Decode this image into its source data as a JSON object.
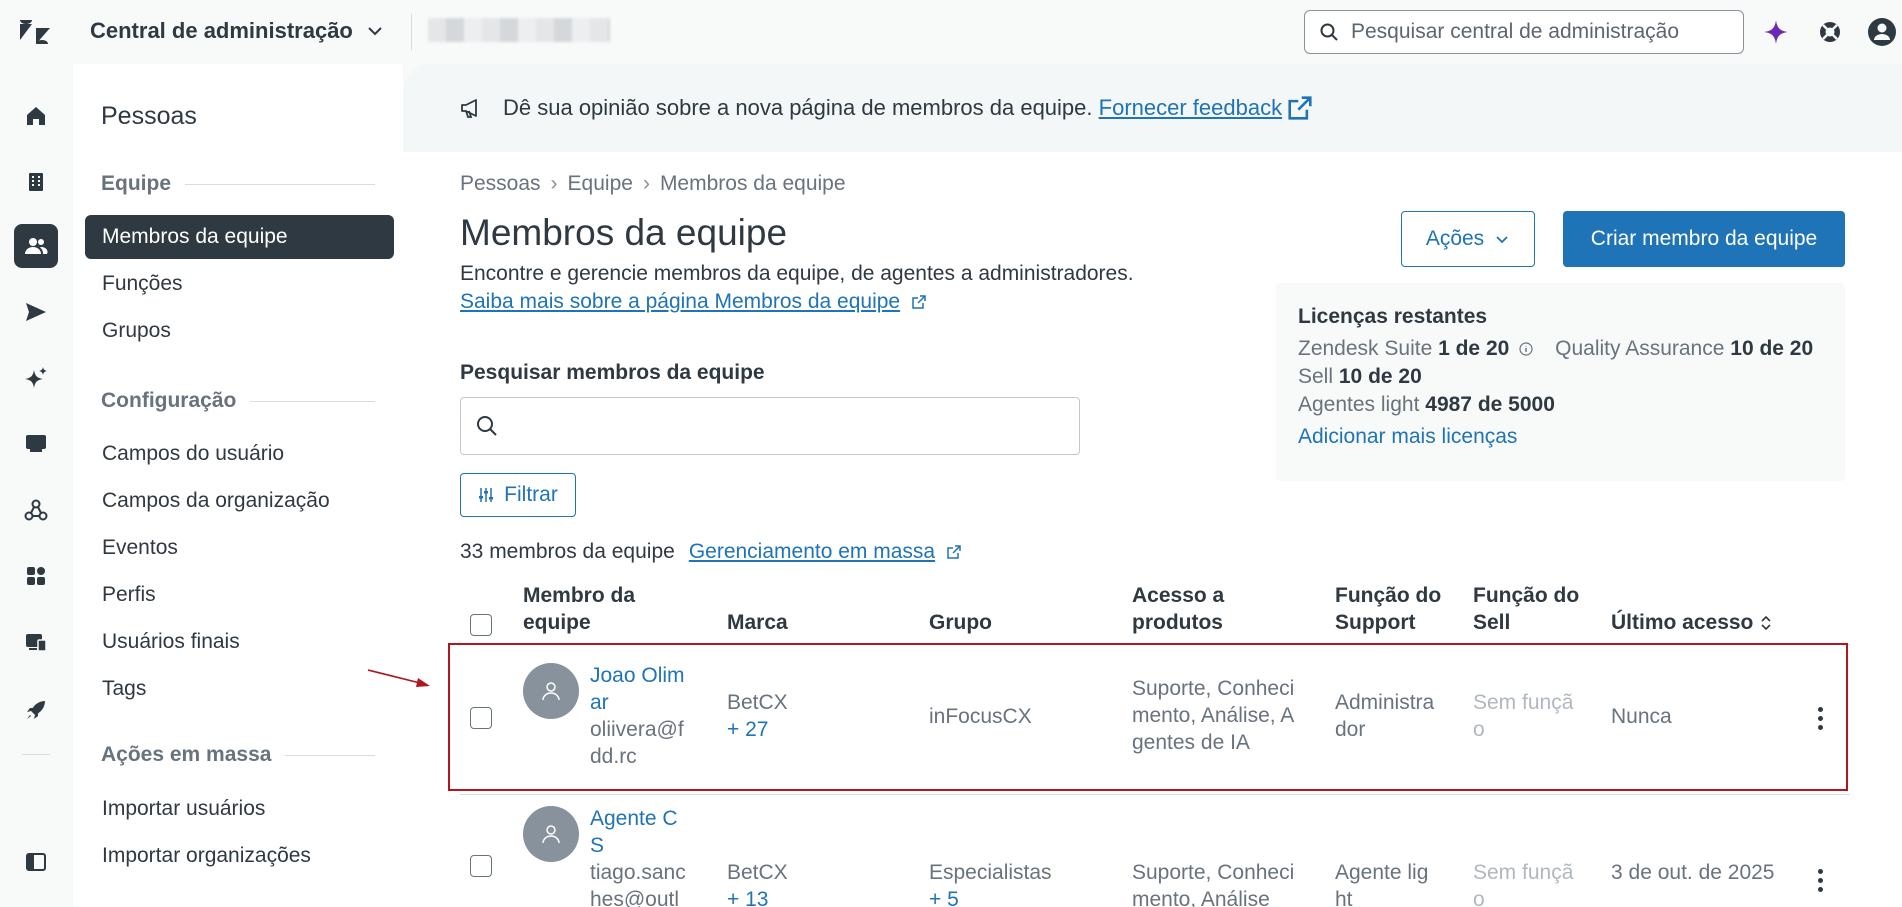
{
  "topbar": {
    "product_title": "Central de administração",
    "search_placeholder": "Pesquisar central de administração"
  },
  "subnav": {
    "title": "Pessoas",
    "sections": [
      {
        "heading": "Equipe",
        "items": [
          "Membros da equipe",
          "Funções",
          "Grupos"
        ]
      },
      {
        "heading": "Configuração",
        "items": [
          "Campos do usuário",
          "Campos da organização",
          "Eventos",
          "Perfis",
          "Usuários finais",
          "Tags"
        ]
      },
      {
        "heading": "Ações em massa",
        "items": [
          "Importar usuários",
          "Importar organizações"
        ]
      }
    ]
  },
  "banner": {
    "text": "Dê sua opinião sobre a nova página de membros da equipe.",
    "link": "Fornecer feedback"
  },
  "breadcrumb": [
    "Pessoas",
    "Equipe",
    "Membros da equipe"
  ],
  "page": {
    "title": "Membros da equipe",
    "description": "Encontre e gerencie membros da equipe, de agentes a administradores.",
    "learn_more": "Saiba mais sobre a página Membros da equipe",
    "actions_button": "Ações",
    "create_button": "Criar membro da equipe"
  },
  "licenses": {
    "title": "Licenças restantes",
    "zendesk_suite_label": "Zendesk Suite",
    "zendesk_suite_value": "1 de 20",
    "qa_label": "Quality Assurance",
    "qa_value": "10 de 20",
    "sell_label": "Sell",
    "sell_value": "10 de 20",
    "light_label": "Agentes light",
    "light_value": "4987 de 5000",
    "add_link": "Adicionar mais licenças"
  },
  "search": {
    "label": "Pesquisar membros da equipe",
    "placeholder": "",
    "filter_button": "Filtrar"
  },
  "table": {
    "count": "33 membros da equipe",
    "bulk_link": "Gerenciamento em massa",
    "columns": {
      "member": [
        "Membro da",
        "equipe"
      ],
      "brand": "Marca",
      "group": "Grupo",
      "access": [
        "Acesso a",
        "produtos"
      ],
      "support_role": [
        "Função do",
        "Support"
      ],
      "sell_role": [
        "Função do",
        "Sell"
      ],
      "last_access": "Último acesso"
    },
    "rows": [
      {
        "name": [
          "Joao Olim",
          "ar"
        ],
        "email": [
          "oliivera@f",
          "dd.rc"
        ],
        "brand": "BetCX",
        "brand_more": "+ 27",
        "group": "inFocusCX",
        "group_more": "",
        "access": [
          "Suporte, Conheci",
          "mento, Análise, A",
          "gentes de IA"
        ],
        "support_role": [
          "Administra",
          "dor"
        ],
        "sell_role": [
          "Sem funçã",
          "o"
        ],
        "last_access": "Nunca"
      },
      {
        "name": [
          "Agente C",
          "S"
        ],
        "email": [
          "tiago.sanc",
          "hes@outl"
        ],
        "brand": "BetCX",
        "brand_more": "+ 13",
        "group": "Especialistas",
        "group_more": "+ 5",
        "access": [
          "Suporte, Conheci",
          "mento, Análise"
        ],
        "support_role": [
          "Agente lig",
          "ht"
        ],
        "sell_role": [
          "Sem funçã",
          "o"
        ],
        "last_access": "3 de out. de 2025"
      }
    ]
  },
  "colors": {
    "accent": "#1f73b7",
    "dark": "#2f3941",
    "highlight": "#b0161e"
  },
  "icons": [
    "zendesk-logo-icon",
    "chevron-down-icon",
    "search-icon",
    "ai-sparkle-icon",
    "help-icon",
    "user-profile-icon",
    "home-icon",
    "building-icon",
    "people-icon",
    "send-icon",
    "sparkles-icon",
    "chat-icon",
    "objects-icon",
    "apps-icon",
    "workspaces-icon",
    "rocket-icon",
    "sidebar-toggle-icon",
    "megaphone-icon",
    "external-link-icon",
    "info-icon",
    "filter-icon",
    "sort-icon",
    "more-vertical-icon"
  ]
}
